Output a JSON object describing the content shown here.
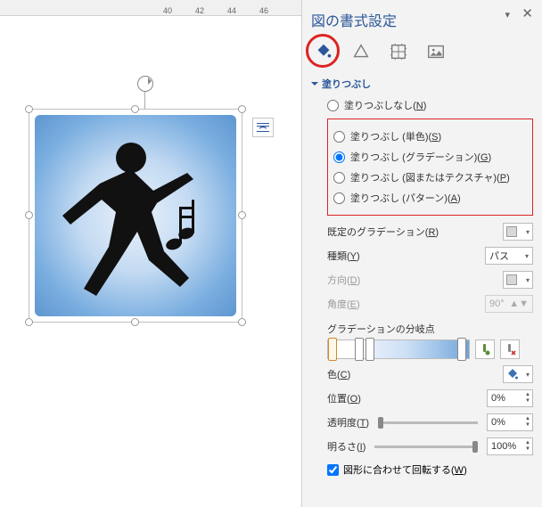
{
  "ruler": {
    "ticks": [
      "40",
      "42",
      "44",
      "46"
    ]
  },
  "pane": {
    "title": "図の書式設定",
    "close_glyph": "✕",
    "dropdown_glyph": "▾"
  },
  "section": {
    "title": "塗りつぶし"
  },
  "radios": {
    "none": {
      "label": "塗りつぶしなし(",
      "key": "N",
      "tail": ")"
    },
    "solid": {
      "label": "塗りつぶし (単色)(",
      "key": "S",
      "tail": ")"
    },
    "gradient": {
      "label": "塗りつぶし (グラデーション)(",
      "key": "G",
      "tail": ")"
    },
    "picture": {
      "label": "塗りつぶし (図またはテクスチャ)(",
      "key": "P",
      "tail": ")"
    },
    "pattern": {
      "label": "塗りつぶし (パターン)(",
      "key": "A",
      "tail": ")"
    }
  },
  "fields": {
    "preset": {
      "label": "既定のグラデーション(",
      "key": "R",
      "tail": ")"
    },
    "type": {
      "label": "種類(",
      "key": "Y",
      "tail": ")",
      "value": "パス"
    },
    "direction": {
      "label": "方向(",
      "key": "D",
      "tail": ")"
    },
    "angle": {
      "label": "角度(",
      "key": "E",
      "tail": ")",
      "value": "90°"
    },
    "stops_title": "グラデーションの分岐点",
    "color": {
      "label": "色(",
      "key": "C",
      "tail": ")"
    },
    "position": {
      "label": "位置(",
      "key": "O",
      "tail": ")",
      "value": "0%"
    },
    "trans": {
      "label": "透明度(",
      "key": "T",
      "tail": ")",
      "value": "0%"
    },
    "bright": {
      "label": "明るさ(",
      "key": "I",
      "tail": ")",
      "value": "100%"
    },
    "rotate": {
      "label": "図形に合わせて回転する(",
      "key": "W",
      "tail": ")"
    }
  },
  "icons": {
    "add_stop": "📎",
    "del_stop": "✖"
  }
}
